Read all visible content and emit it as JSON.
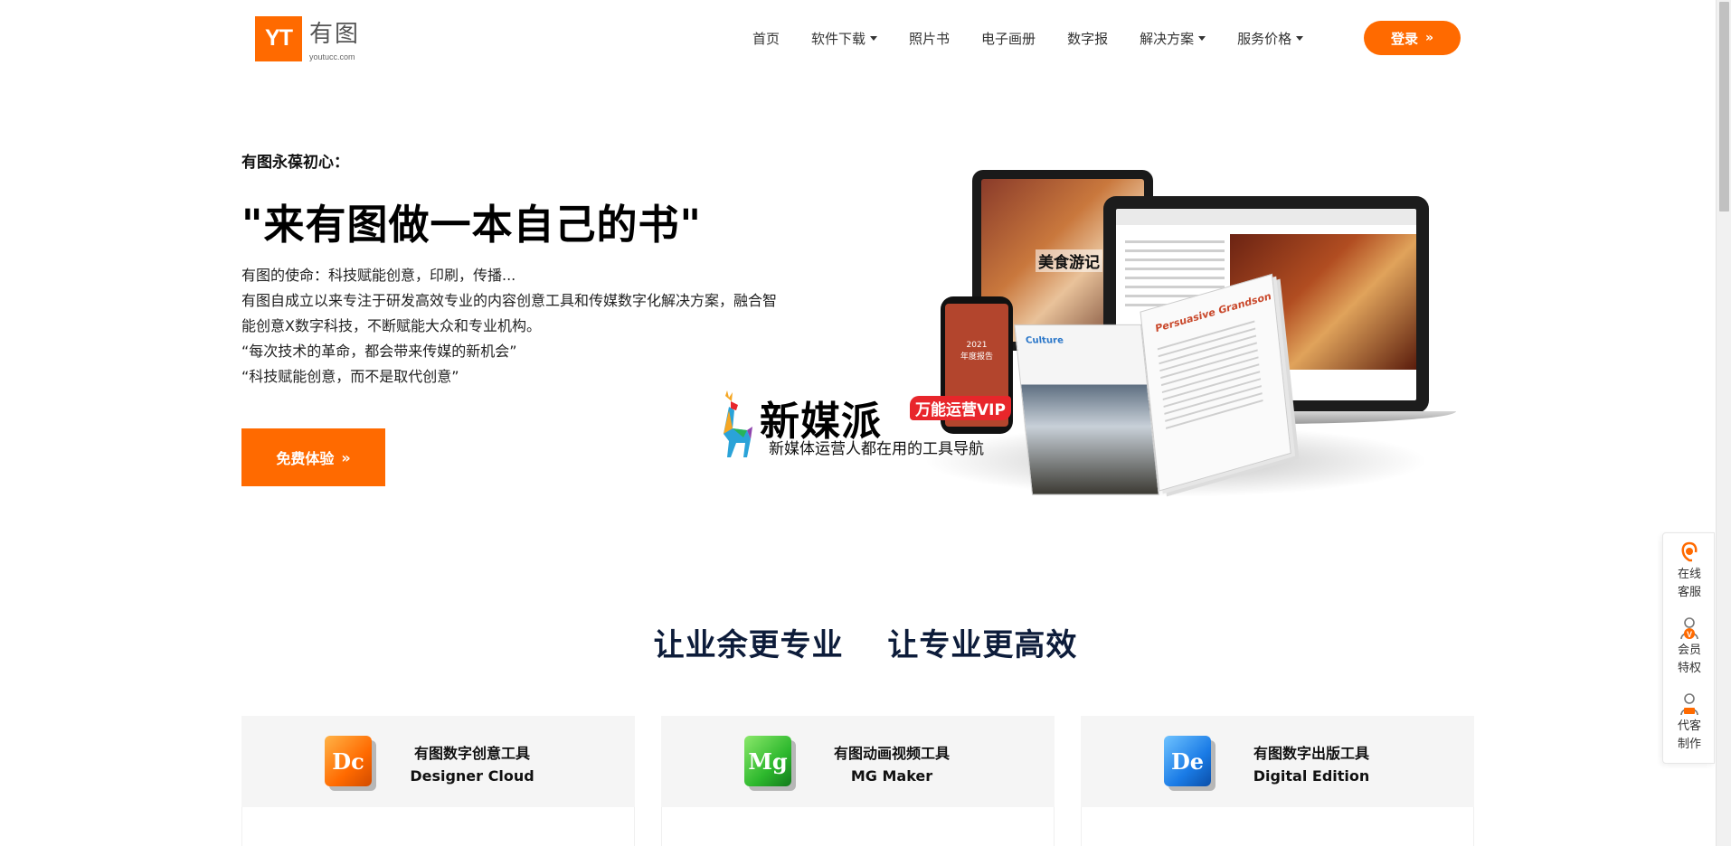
{
  "logo": {
    "mark": "YT",
    "cn": "有图",
    "en": "youtucc.com"
  },
  "nav": {
    "items": [
      {
        "label": "首页",
        "dropdown": false
      },
      {
        "label": "软件下载",
        "dropdown": true
      },
      {
        "label": "照片书",
        "dropdown": false
      },
      {
        "label": "电子画册",
        "dropdown": false
      },
      {
        "label": "数字报",
        "dropdown": false
      },
      {
        "label": "解决方案",
        "dropdown": true
      },
      {
        "label": "服务价格",
        "dropdown": true
      }
    ],
    "login_label": "登录",
    "login_chevron": "»"
  },
  "hero": {
    "kicker": "有图永葆初心：",
    "title": "\"来有图做一本自己的书\"",
    "desc": [
      "有图的使命：科技赋能创意，印刷，传播...",
      "有图自成立以来专注于研发高效专业的内容创意工具和传媒数字化解决方案，融合智",
      "能创意X数字科技，不断赋能大众和专业机构。",
      "“每次技术的革命，都会带来传媒的新机会”",
      "“科技赋能创意，而不是取代创意”"
    ],
    "cta_label": "免费体验",
    "cta_chevron": "»",
    "art": {
      "tablet_text": "美食游记",
      "phone_year": "2021",
      "phone_text": "年度报告",
      "book_left": "Culture",
      "book_right": "Persuasive Grandson"
    }
  },
  "ad": {
    "brand": "新媒派",
    "vip": "万能运营VIP",
    "tagline": "新媒体运营人都在用的工具导航"
  },
  "slogan": {
    "left": "让业余更专业",
    "right": "让专业更高效"
  },
  "products": [
    {
      "icon": "Dc",
      "name": "有图数字创意工具",
      "sub": "Designer Cloud",
      "color": "#ff6a00"
    },
    {
      "icon": "Mg",
      "name": "有图动画视频工具",
      "sub": "MG Maker",
      "color": "#2db82d"
    },
    {
      "icon": "De",
      "name": "有图数字出版工具",
      "sub": "Digital Edition",
      "color": "#1a7be6"
    }
  ],
  "side_panel": [
    {
      "icon": "headset-icon",
      "line1": "在线",
      "line2": "客服"
    },
    {
      "icon": "vip-member-icon",
      "line1": "会员",
      "line2": "特权"
    },
    {
      "icon": "designer-icon",
      "line1": "代客",
      "line2": "制作"
    }
  ],
  "colors": {
    "accent": "#ff6a00",
    "heading": "#0d1c3a"
  }
}
